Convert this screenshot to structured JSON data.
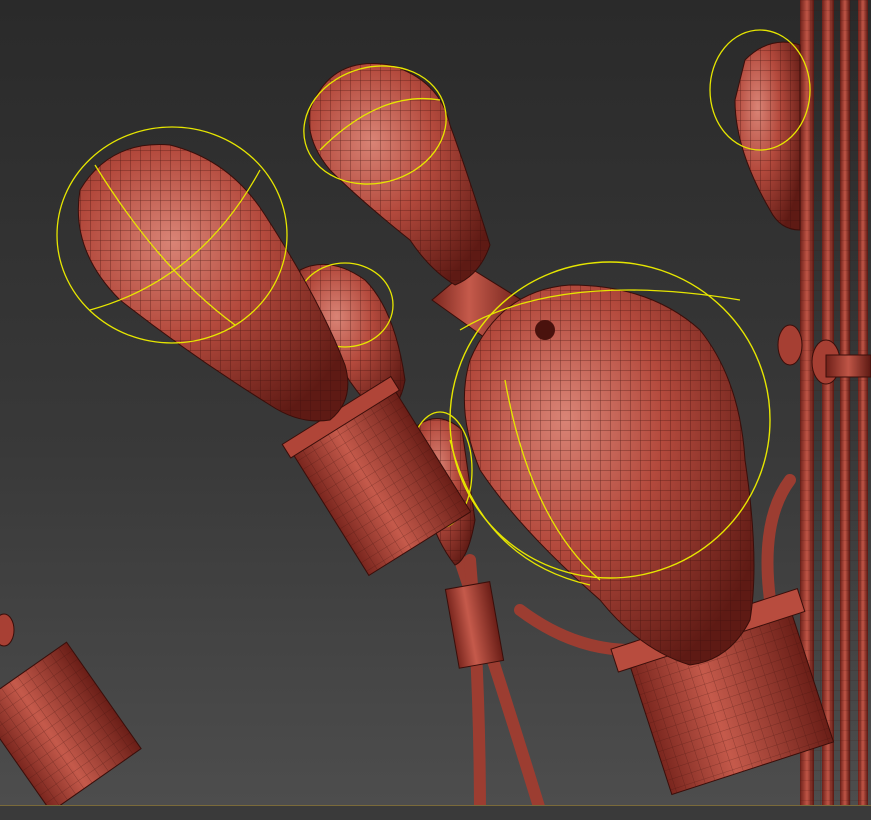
{
  "app": {
    "viewport_label": ""
  },
  "scene": {
    "description_visible_text": "",
    "colors": {
      "background_top": "#2a2a2a",
      "background_bottom": "#4e4e4e",
      "mesh": "#b84a3d",
      "mesh_dark": "#6e2019",
      "wire": "#3a0e0a",
      "selection": "#e6e600"
    },
    "objects": [
      {
        "name": "bulb-left-large",
        "type": "edison-bulb",
        "selected": true
      },
      {
        "name": "bulb-top-center",
        "type": "edison-bulb",
        "selected": true
      },
      {
        "name": "bulb-top-right",
        "type": "edison-bulb",
        "selected": true
      },
      {
        "name": "bulb-small-middle",
        "type": "edison-bulb",
        "selected": true
      },
      {
        "name": "bulb-front-large",
        "type": "edison-bulb",
        "selected": true
      },
      {
        "name": "bulb-lower-center",
        "type": "edison-bulb",
        "selected": true
      },
      {
        "name": "socket-bottom-left",
        "type": "socket",
        "selected": false
      },
      {
        "name": "chandelier-stem",
        "type": "frame",
        "selected": false
      }
    ]
  }
}
